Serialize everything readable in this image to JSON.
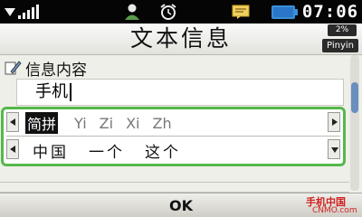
{
  "status_bar": {
    "time": "07:06",
    "icons": [
      "signal-icon",
      "person-icon",
      "alarm-icon",
      "message-icon",
      "battery-icon"
    ]
  },
  "title_bar": {
    "title": "文本信息",
    "char_percent": "2%",
    "ime_mode": "Pinyin"
  },
  "content": {
    "field_label": "信息内容",
    "field_icon": "edit-pen-icon",
    "message_text": "手机"
  },
  "ime_panel": {
    "pinyin_options": [
      "简拼",
      "Yi",
      "Zi",
      "Xi",
      "Zh"
    ],
    "selected_pinyin": "简拼",
    "candidates": [
      "中国",
      "一个",
      "这个"
    ]
  },
  "softkey": {
    "center_label": "OK"
  },
  "watermark": {
    "cn": "手机中国",
    "en": "CNMO.com"
  },
  "colors": {
    "ime_border": "#55b84a",
    "status_bar_bg": "#050505",
    "battery": "#2a77c9"
  }
}
